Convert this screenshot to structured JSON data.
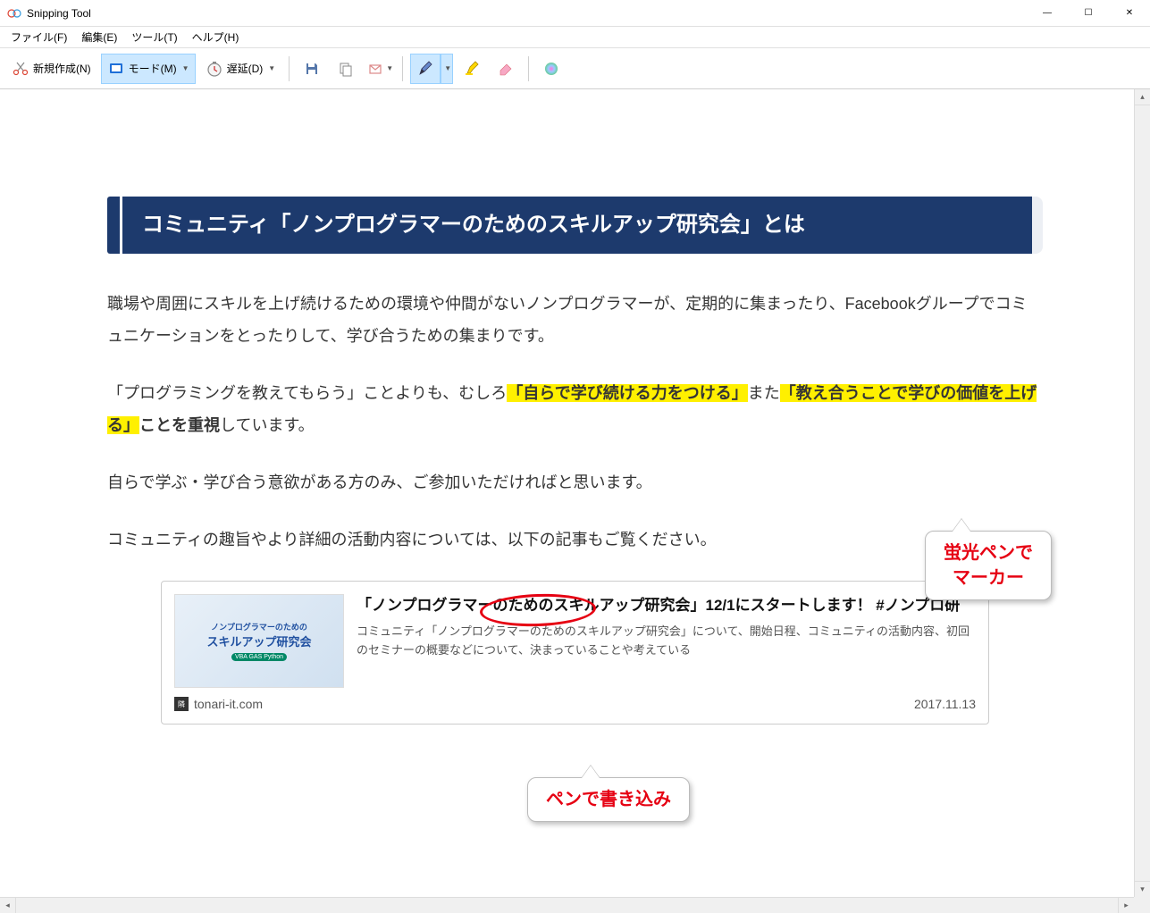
{
  "app": {
    "title": "Snipping Tool",
    "window_controls": {
      "min": "—",
      "max": "☐",
      "close": "✕"
    }
  },
  "menu": {
    "file": "ファイル(F)",
    "edit": "編集(E)",
    "tools": "ツール(T)",
    "help": "ヘルプ(H)"
  },
  "toolbar": {
    "new": "新規作成(N)",
    "mode": "モード(M)",
    "delay": "遅延(D)"
  },
  "content": {
    "heading": "コミュニティ「ノンプログラマーのためのスキルアップ研究会」とは",
    "para1": "職場や周囲にスキルを上げ続けるための環境や仲間がないノンプログラマーが、定期的に集まったり、Facebookグループでコミュニケーションをとったりして、学び合うための集まりです。",
    "para2_pre": "「プログラミングを教えてもらう」ことよりも、むしろ",
    "para2_hl1": "「自らで学び続ける力をつける」",
    "para2_mid": "また",
    "para2_hl2": "「教え合うことで学びの価値を上げる」",
    "para2_post": "ことを重視",
    "para2_end": "しています。",
    "para3": "自らで学ぶ・学び合う意欲がある方のみ、ご参加いただければと思います。",
    "para4": "コミュニティの趣旨やより詳細の活動内容については、以下の記事もご覧ください。"
  },
  "card": {
    "title": "「ノンプログラマーのためのスキルアップ研究会」12/1にスタートします！ #ノンプロ研",
    "desc": "コミュニティ「ノンプログラマーのためのスキルアップ研究会」について、開始日程、コミュニティの活動内容、初回のセミナーの概要などについて、決まっていることや考えている",
    "source": "tonari-it.com",
    "date": "2017.11.13",
    "thumb_line1": "ノンプログラマーのための",
    "thumb_line2": "スキルアップ研究会",
    "thumb_badge": "VBA GAS Python"
  },
  "callouts": {
    "marker_l1": "蛍光ペンで",
    "marker_l2": "マーカー",
    "pen": "ペンで書き込み"
  }
}
